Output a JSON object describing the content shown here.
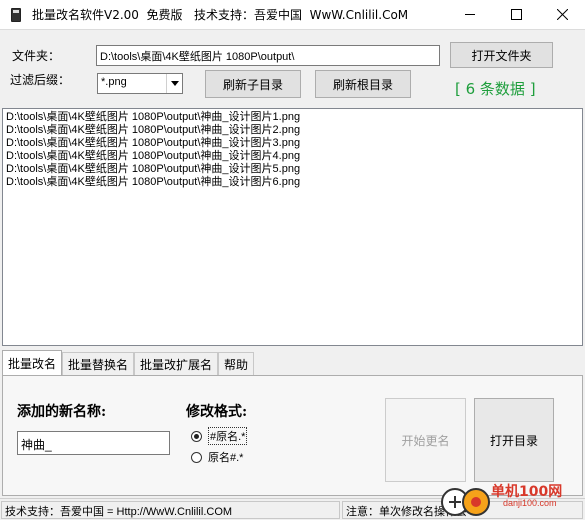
{
  "window": {
    "title": "批量改名软件V2.00  免费版   技术支持：吾爱中国  WwW.Cnlilil.CoM"
  },
  "folder": {
    "label": "文件夹：",
    "path": "D:\\tools\\桌面\\4K壁纸图片 1080P\\output\\",
    "open_button": "打开文件夹"
  },
  "filter": {
    "label": "过滤后缀：",
    "value": "*.png",
    "refresh_sub_button": "刷新子目录",
    "refresh_root_button": "刷新根目录"
  },
  "record_count": "[ 6 条数据 ]",
  "files": [
    "D:\\tools\\桌面\\4K壁纸图片 1080P\\output\\神曲_设计图片1.png",
    "D:\\tools\\桌面\\4K壁纸图片 1080P\\output\\神曲_设计图片2.png",
    "D:\\tools\\桌面\\4K壁纸图片 1080P\\output\\神曲_设计图片3.png",
    "D:\\tools\\桌面\\4K壁纸图片 1080P\\output\\神曲_设计图片4.png",
    "D:\\tools\\桌面\\4K壁纸图片 1080P\\output\\神曲_设计图片5.png",
    "D:\\tools\\桌面\\4K壁纸图片 1080P\\output\\神曲_设计图片6.png"
  ],
  "tabs": [
    "批量改名",
    "批量替换名",
    "批量改扩展名",
    "帮助"
  ],
  "rename": {
    "new_name_label": "添加的新名称:",
    "new_name_value": "神曲_",
    "format_label": "修改格式:",
    "format_option_1": "#原名.*",
    "format_option_2": "原名#.*",
    "start_button": "开始更名",
    "open_dir_button": "打开目录"
  },
  "status": {
    "left": "技术支持：吾爱中国 = Http://WwW.Cnlilil.COM",
    "right": "注意：单次修改名操作会"
  },
  "watermark": {
    "text": "单机100网",
    "url": "danji100.com"
  },
  "colors": {
    "count_text": "#1e9e3c",
    "watermark": "#d8382a"
  }
}
